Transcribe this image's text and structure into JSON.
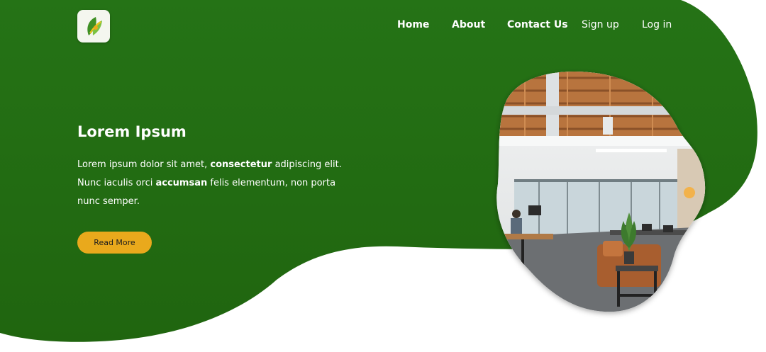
{
  "nav": {
    "home": "Home",
    "about": "About",
    "contact": "Contact Us",
    "signup": "Sign up",
    "login": "Log in"
  },
  "hero": {
    "title": "Lorem Ipsum",
    "text_part1": "Lorem ipsum dolor sit amet, ",
    "text_bold1": "consectetur",
    "text_part2": " adipiscing elit. Nunc iaculis orci ",
    "text_bold2": "accumsan",
    "text_part3": " felis elementum, non porta nunc semper.",
    "button_label": "Read More"
  },
  "colors": {
    "green": "#257316",
    "green_dark": "#1f6012",
    "accent": "#e9a91c",
    "text": "#ffffff"
  },
  "icons": {
    "logo": "leaf-logo-icon",
    "photo": "office-photo"
  }
}
